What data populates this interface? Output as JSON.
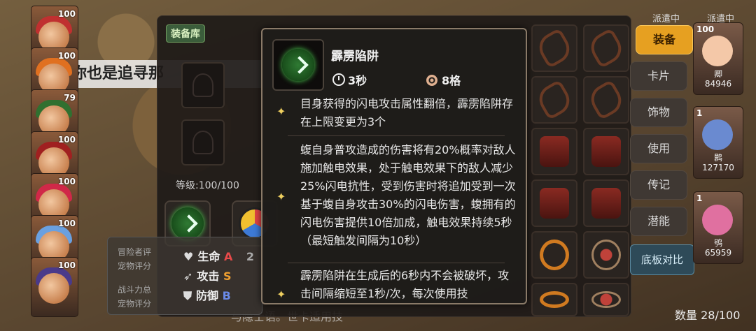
{
  "scene": {
    "dialog_text": "你也是追寻那",
    "hint_text": "与隐士语。世卡适用技"
  },
  "hero_column": {
    "cards": [
      {
        "level": "100",
        "hair": "#c03030"
      },
      {
        "level": "100",
        "hair": "#e07020"
      },
      {
        "level": "79",
        "hair": "#307030"
      },
      {
        "level": "100",
        "hair": "#a02020"
      },
      {
        "level": "100",
        "hair": "#d02848"
      },
      {
        "level": "100",
        "hair": "#6aa0e0"
      },
      {
        "level": "100",
        "hair": "#4a3a8a"
      }
    ]
  },
  "equip_panel": {
    "library_tab": "装备库",
    "level_label": "等级:100/100",
    "stats": {
      "faded_lines": [
        "冒险者评",
        "宠物评分",
        "战斗力总",
        "宠物评分"
      ],
      "rows": [
        {
          "icon": "♥",
          "label": "生命",
          "grade": "A",
          "value": "2"
        },
        {
          "icon": "➶",
          "label": "攻击",
          "grade": "S",
          "value": ""
        },
        {
          "icon": "⛊",
          "label": "防御",
          "grade": "B",
          "value": ""
        }
      ]
    }
  },
  "menu": {
    "equip": "装备",
    "card": "卡片",
    "accessory": "饰物",
    "use": "使用",
    "biography": "传记",
    "potential": "潜能",
    "compare": "底板对比"
  },
  "roster": {
    "dispatch_labels": [
      "派遣中",
      "派遣中"
    ],
    "cards": [
      {
        "num": "100",
        "name": "卿",
        "power": "84946",
        "face": "#f4c8a8"
      },
      {
        "num": "1",
        "name": "鹮",
        "power": "127170",
        "face": "#6a8ad0"
      },
      {
        "num": "1",
        "name": "鸮",
        "power": "65959",
        "face": "#e070a0"
      }
    ],
    "count_label": "数量 28/100"
  },
  "tooltip": {
    "name": "霹雳陷阱",
    "cooldown": "3秒",
    "range": "8格",
    "bullets": [
      "目身获得的闪电攻击属性翻倍，霹雳陷阱存在上限变更为3个",
      "蝮自身普攻造成的伤害将有20%概率对敌人施加触电效果，处于触电效果下的敌人减少25%闪电抗性，受到伤害时将追加受到一次基于蝮自身攻击30%的闪电伤害，蝮拥有的闪电伤害提供10倍加成，触电效果持续5秒（最短触发间隔为10秒）",
      "霹雳陷阱在生成后的6秒内不会被破坏，攻击间隔缩短至1秒/次，每次使用技"
    ]
  },
  "colors": {
    "accent_gold": "#e6a021",
    "skill_green": "#4bd04f",
    "grade_a": "#e84a4a",
    "grade_s": "#f0a030",
    "grade_b": "#6a8ae8"
  },
  "icons": {
    "skill": "lightning-trap-icon",
    "cooldown": "clock-icon",
    "range": "target-icon",
    "bullet": "sparkle-icon"
  }
}
